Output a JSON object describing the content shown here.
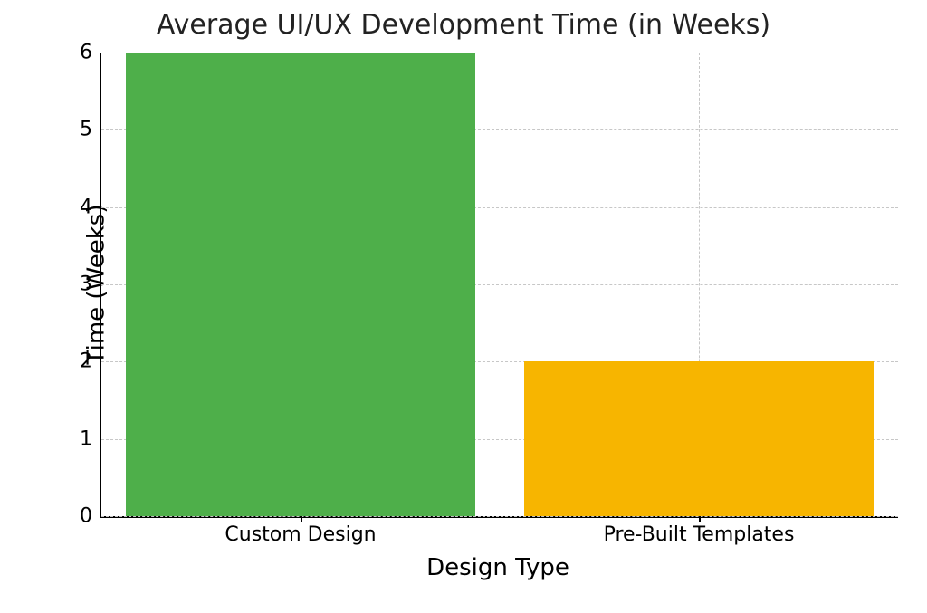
{
  "chart_data": {
    "type": "bar",
    "title": "Average UI/UX Development Time (in Weeks)",
    "xlabel": "Design Type",
    "ylabel": "Time (Weeks)",
    "categories": [
      "Custom Design",
      "Pre-Built Templates"
    ],
    "values": [
      6,
      2
    ],
    "colors": [
      "#4eaf4a",
      "#f7b500"
    ],
    "ylim": [
      0,
      6
    ],
    "yticks": [
      0,
      1,
      2,
      3,
      4,
      5,
      6
    ],
    "grid": true
  },
  "ytick_labels": {
    "0": "0",
    "1": "1",
    "2": "2",
    "3": "3",
    "4": "4",
    "5": "5",
    "6": "6"
  }
}
